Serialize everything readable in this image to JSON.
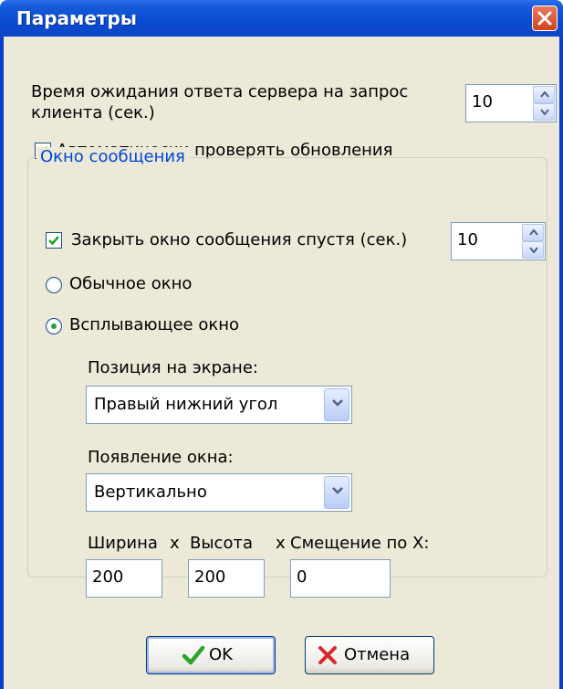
{
  "dialog": {
    "title": "Параметры"
  },
  "server_timeout": {
    "label_line1": "Время ожидания ответа сервера на запрос",
    "label_line2": "клиента (сек.)",
    "value": "10"
  },
  "auto_update": {
    "label": "Автоматически проверять обновления",
    "checked": true
  },
  "message_window": {
    "group_title": "Окно сообщения",
    "close_after": {
      "label": "Закрыть окно сообщения спустя (сек.)",
      "checked": true,
      "value": "10"
    },
    "radio_normal": {
      "label": "Обычное окно",
      "selected": false
    },
    "radio_popup": {
      "label": "Всплывающее окно",
      "selected": true
    },
    "position": {
      "label": "Позиция на экране:",
      "value": "Правый нижний угол"
    },
    "appearance": {
      "label": "Появление окна:",
      "value": "Вертикально"
    },
    "size_labels": {
      "width": "Ширина",
      "x1": "x",
      "height": "Высота",
      "x2": "x",
      "offset": "Смещение по X:"
    },
    "width_value": "200",
    "height_value": "200",
    "offset_value": "0"
  },
  "buttons": {
    "ok_label": "OK",
    "cancel_label": "Отмена"
  },
  "colors": {
    "titlebar": "#0a4bd0",
    "close_button": "#d2431c",
    "group_title": "#0046d5",
    "dialog_bg": "#ece9d8"
  },
  "icons": {
    "close": "close-icon",
    "ok": "checkmark-icon",
    "cancel": "cross-icon"
  }
}
